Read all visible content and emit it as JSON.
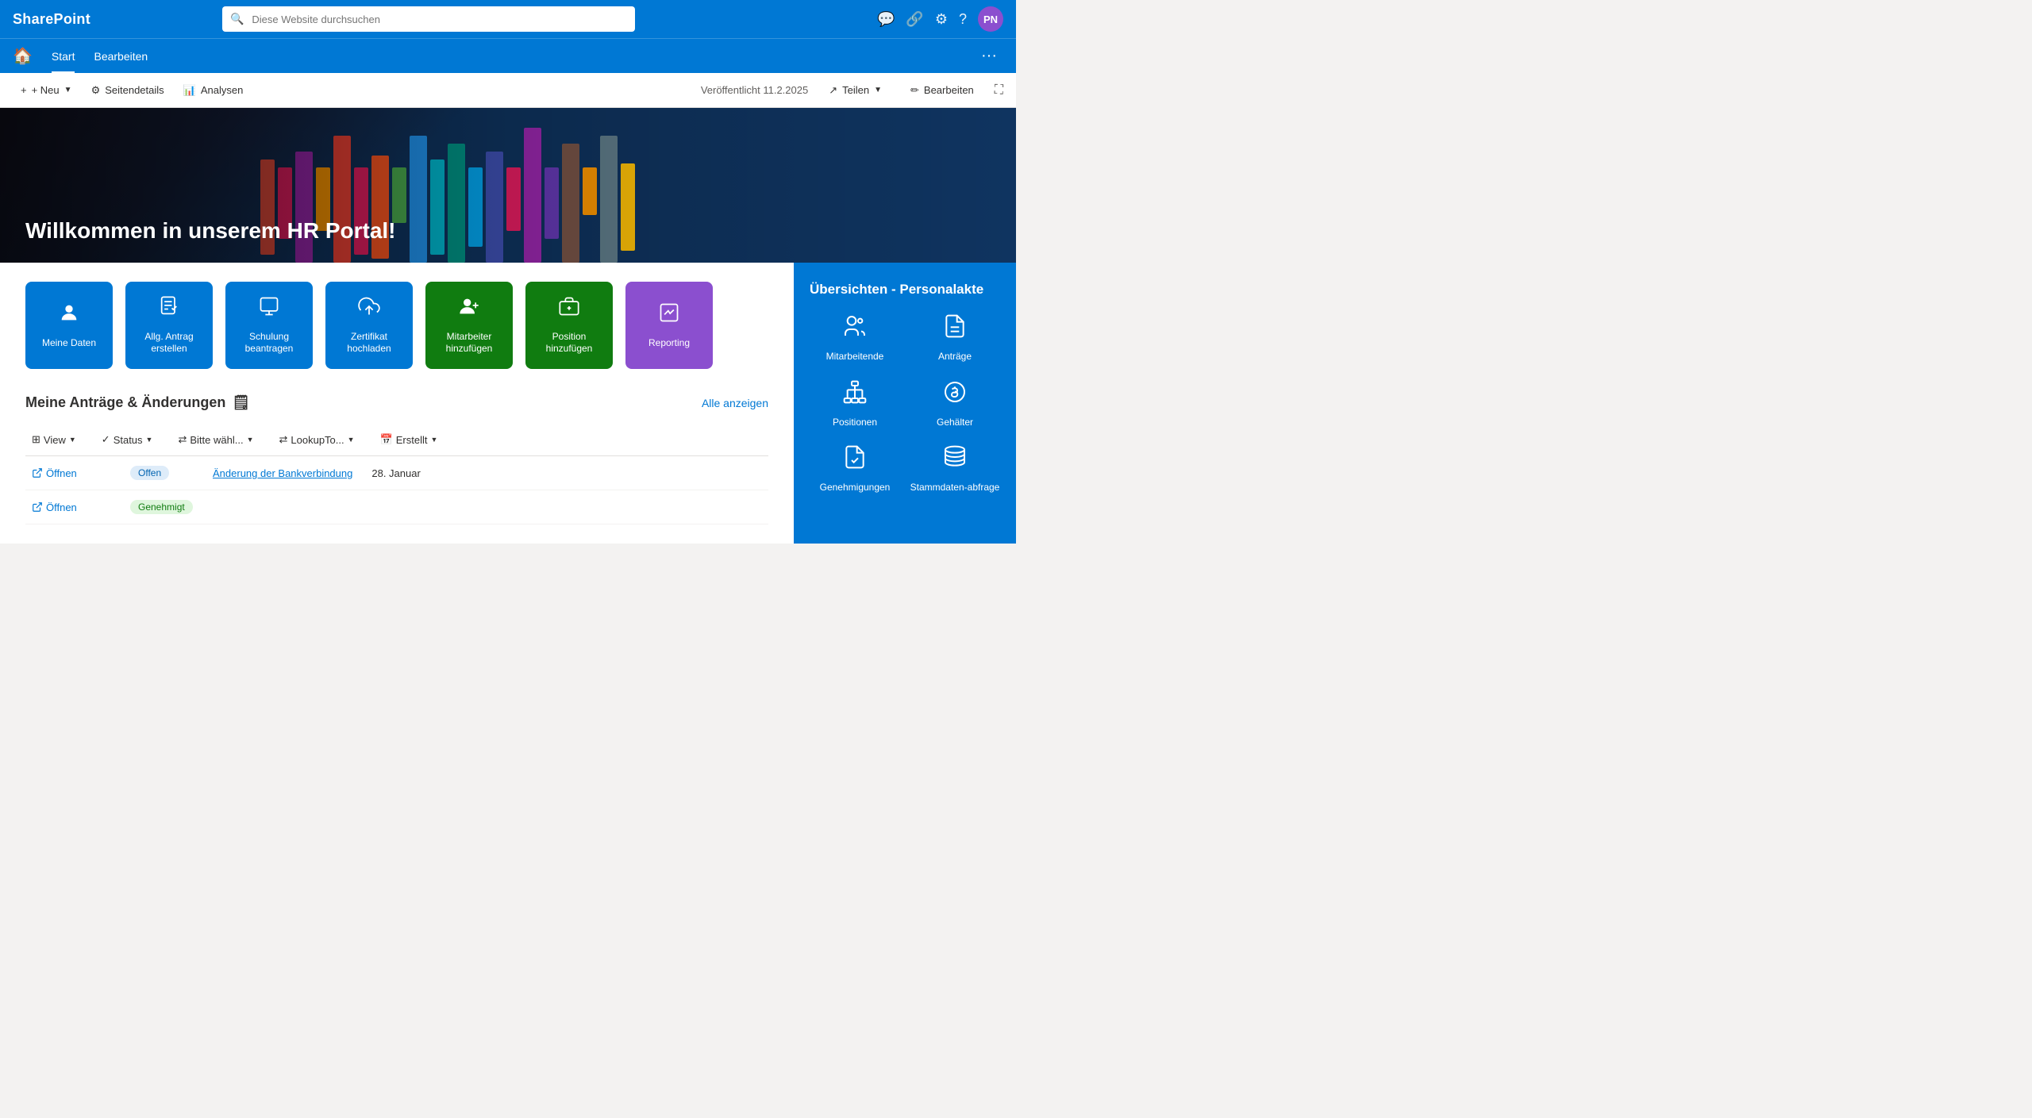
{
  "brand": "SharePoint",
  "search": {
    "placeholder": "Diese Website durchsuchen"
  },
  "topnav_actions": {
    "comment_icon": "💬",
    "share_icon": "🔗",
    "settings_icon": "⚙",
    "help_icon": "?",
    "avatar": "PN"
  },
  "secondary_nav": {
    "home_icon": "🏠",
    "links": [
      {
        "label": "Start",
        "active": true
      },
      {
        "label": "Bearbeiten",
        "active": false
      }
    ],
    "more_icon": "···"
  },
  "toolbar": {
    "new_label": "+ Neu",
    "page_details_label": "Seitendetails",
    "analysen_label": "Analysen",
    "published_label": "Veröffentlicht 11.2.2025",
    "share_label": "Teilen",
    "edit_label": "Bearbeiten",
    "page_details_icon": "⚙",
    "analysen_icon": "📊",
    "share_icon": "↗",
    "edit_icon": "✏",
    "expand_icon": "⛶"
  },
  "hero": {
    "title": "Willkommen in unserem HR Portal!"
  },
  "quick_actions": [
    {
      "label": "Meine Daten",
      "color": "#0078d4",
      "icon": "👤"
    },
    {
      "label": "Allg. Antrag erstellen",
      "color": "#0078d4",
      "icon": "📝"
    },
    {
      "label": "Schulung beantragen",
      "color": "#0078d4",
      "icon": "📋"
    },
    {
      "label": "Zertifikat hochladen",
      "color": "#0078d4",
      "icon": "⬆"
    },
    {
      "label": "Mitarbeiter hinzufügen",
      "color": "#107c10",
      "icon": "👥"
    },
    {
      "label": "Position hinzufügen",
      "color": "#107c10",
      "icon": "💼"
    },
    {
      "label": "Reporting",
      "color": "#8B4FCF",
      "icon": "📊"
    }
  ],
  "section": {
    "title": "Meine Anträge & Änderungen",
    "emoji": "🗒",
    "all_link": "Alle anzeigen"
  },
  "filters": [
    {
      "label": "View",
      "icon": "⊞"
    },
    {
      "label": "Status",
      "icon": "✓"
    },
    {
      "label": "Bitte wähl...",
      "icon": "⇄"
    },
    {
      "label": "LookupTo...",
      "icon": "⇄"
    },
    {
      "label": "Erstellt",
      "icon": "📅"
    }
  ],
  "list_rows": [
    {
      "action": "Öffnen",
      "status": "Offen",
      "status_type": "offen",
      "type": "Änderung der Bankverbindung",
      "date": "28. Januar"
    },
    {
      "action": "Öffnen",
      "status": "Genehmigt",
      "status_type": "green",
      "type": "",
      "date": ""
    }
  ],
  "sidebar": {
    "title": "Übersichten - Personalakte",
    "items": [
      {
        "label": "Mitarbeitende",
        "icon": "👥"
      },
      {
        "label": "Anträge",
        "icon": "📄"
      },
      {
        "label": "Positionen",
        "icon": "🗂"
      },
      {
        "label": "Gehälter",
        "icon": "💰"
      },
      {
        "label": "Genehmigungen",
        "icon": "📋"
      },
      {
        "label": "Stammdaten-abfrage",
        "icon": "🔎"
      }
    ]
  }
}
